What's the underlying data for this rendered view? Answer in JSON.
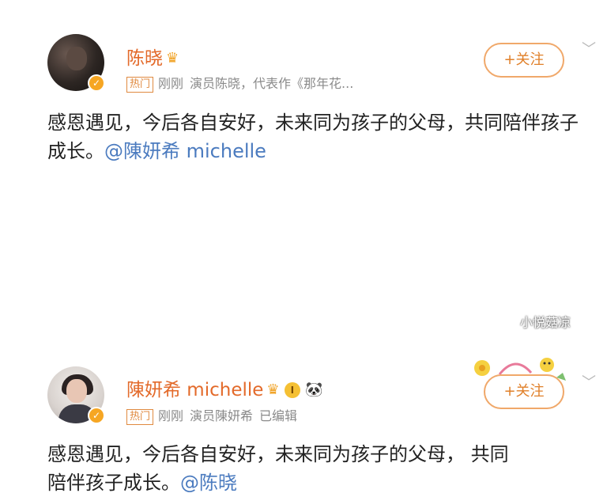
{
  "posts": [
    {
      "author": "陈晓",
      "hot_tag": "热门",
      "time": "刚刚",
      "desc": "演员陈晓，代表作《那年花...",
      "follow_label": "+关注",
      "content_text": "感恩遇见，今后各自安好，未来同为孩子的父母，共同陪伴孩子成长。",
      "mention": "@陳妍希 michelle"
    },
    {
      "author": "陳妍希 michelle",
      "vip_label": "I",
      "hot_tag": "热门",
      "time": "刚刚",
      "desc": "演员陳妍希",
      "edited": "已编辑",
      "follow_label": "+关注",
      "content_line1": "感恩遇见，今后各自安好，未来同为孩子的父母，  共同",
      "content_line2": "陪伴孩子成长。",
      "mention": "@陈晓"
    }
  ],
  "watermark": "小悦菇凉",
  "colors": {
    "name": "#e36a2a",
    "mention": "#4b7bbf",
    "follow": "#e0802a",
    "badge": "#f6a623"
  },
  "icons": [
    "crown-icon",
    "vip-badge-icon",
    "panda-icon",
    "verified-icon",
    "chevron-down-icon"
  ]
}
